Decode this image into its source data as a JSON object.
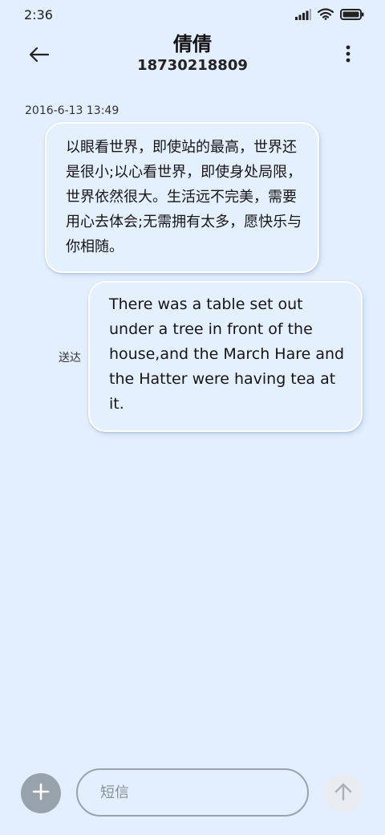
{
  "status_bar": {
    "time": "2:36",
    "signal_icon": "signal-icon",
    "wifi_icon": "wifi-icon",
    "battery_icon": "battery-icon"
  },
  "header": {
    "back_icon": "arrow-left-icon",
    "contact_name": "倩倩",
    "contact_number": "18730218809",
    "more_icon": "more-vertical-icon"
  },
  "conversation": {
    "timestamp": "2016-6-13 13:49",
    "messages": [
      {
        "direction": "incoming",
        "text": "以眼看世界，即使站的最高，世界还是很小;以心看世界，即使身处局限，世界依然很大。生活远不完美，需要用心去体会;无需拥有太多，愿快乐与你相随。"
      },
      {
        "direction": "outgoing",
        "text": "There was a table set out under a tree in front of the house,and the March Hare and the Hatter were having tea at it.",
        "status": "送达"
      }
    ]
  },
  "composer": {
    "add_icon": "plus-icon",
    "placeholder": "短信",
    "value": "",
    "send_icon": "arrow-up-icon"
  },
  "colors": {
    "background": "#e3efff",
    "bubble": "#e5f0ff",
    "add_button": "#98a2ad",
    "send_button": "#e9edf2"
  }
}
